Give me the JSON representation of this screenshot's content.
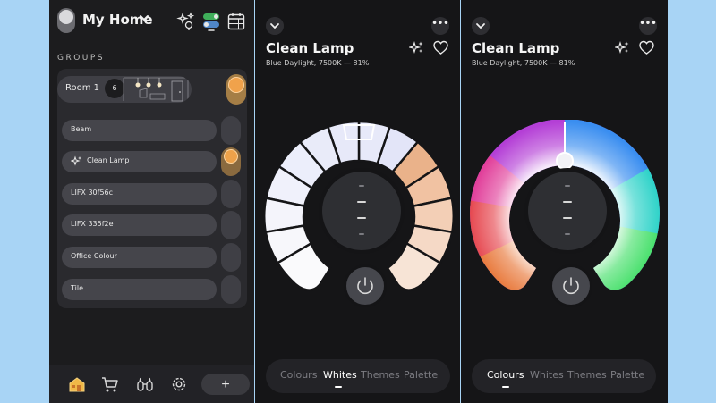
{
  "home": {
    "title": "My Home"
  },
  "groups": {
    "label": "GROUPS",
    "room": {
      "name": "Room 1",
      "count": "6"
    },
    "lights": [
      {
        "name": "Beam",
        "on": false
      },
      {
        "name": "Clean Lamp",
        "on": true
      },
      {
        "name": "LIFX 30f56c",
        "on": false
      },
      {
        "name": "LIFX 335f2e",
        "on": false
      },
      {
        "name": "Office Colour",
        "on": false
      },
      {
        "name": "Tile",
        "on": false
      }
    ]
  },
  "bottom_nav": {
    "add_label": "+"
  },
  "whites_view": {
    "title": "Clean Lamp",
    "subtitle": "Blue Daylight, 7500K — 81%",
    "more_label": "•••",
    "tabs": [
      "Colours",
      "Whites",
      "Themes",
      "Palette"
    ],
    "active_tab": "Whites"
  },
  "colours_view": {
    "title": "Clean Lamp",
    "subtitle": "Blue Daylight, 7500K — 81%",
    "more_label": "•••",
    "tabs": [
      "Colours",
      "Whites",
      "Themes",
      "Palette"
    ],
    "active_tab": "Colours"
  },
  "colors": {
    "accent_orange": "#f0a24b",
    "panel_bg": "#151517",
    "page_bg": "#a8d4f5"
  },
  "icons": [
    "chevron-down-icon",
    "scenes-icon",
    "toggle-view-icon",
    "calendar-icon",
    "home-icon",
    "shop-icon",
    "discover-icon",
    "settings-icon",
    "sparkle-icon",
    "heart-icon",
    "power-icon"
  ]
}
